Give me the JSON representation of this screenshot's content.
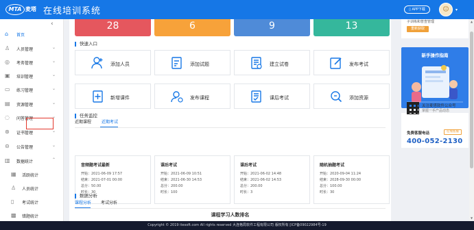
{
  "header": {
    "logo_text": "MTA",
    "logo_name": "麦塔",
    "title": "在线培训系统",
    "app_download": "APP下载"
  },
  "sidebar": {
    "items": [
      {
        "label": "首页",
        "icon": "home-icon",
        "active": true
      },
      {
        "label": "人员管理",
        "icon": "user-icon"
      },
      {
        "label": "考务管理",
        "icon": "exam-icon"
      },
      {
        "label": "培训管理",
        "icon": "training-icon"
      },
      {
        "label": "练习管理",
        "icon": "practice-icon"
      },
      {
        "label": "资源管理",
        "icon": "resource-icon"
      },
      {
        "label": "问答管理",
        "icon": "qa-icon"
      },
      {
        "label": "证书管理",
        "icon": "certificate-icon"
      },
      {
        "label": "公告管理",
        "icon": "announcement-icon"
      },
      {
        "label": "数据统计",
        "icon": "stats-icon",
        "expanded": true
      }
    ],
    "subitems": [
      {
        "label": "活跃统计"
      },
      {
        "label": "人员统计"
      },
      {
        "label": "考试统计"
      },
      {
        "label": "错题统计"
      }
    ]
  },
  "stats": [
    {
      "value": "28",
      "color": "#e5575e"
    },
    {
      "value": "6",
      "color": "#f7a23a"
    },
    {
      "value": "9",
      "color": "#4f8bd8"
    },
    {
      "value": "13",
      "color": "#35b79c"
    }
  ],
  "quick_entry": {
    "title": "快速入口",
    "items": [
      {
        "label": "添加人员",
        "icon": "add-user-icon"
      },
      {
        "label": "添加试题",
        "icon": "add-question-icon"
      },
      {
        "label": "建立试卷",
        "icon": "create-paper-icon"
      },
      {
        "label": "发布考试",
        "icon": "publish-exam-icon"
      },
      {
        "label": "新增课件",
        "icon": "add-courseware-icon"
      },
      {
        "label": "发布课程",
        "icon": "publish-course-icon"
      },
      {
        "label": "课后考试",
        "icon": "post-course-exam-icon"
      },
      {
        "label": "添加资源",
        "icon": "add-resource-icon"
      }
    ]
  },
  "task_monitor": {
    "title": "任务监控",
    "tabs": [
      "近期课程",
      "近期考试"
    ],
    "active_tab": 1,
    "cards": [
      {
        "name": "音频题考试最新",
        "start": "开始：2021-06-09 17:57",
        "end": "结束：2021-07-01 00:00",
        "score": "总分：50.00",
        "duration": "时长：30"
      },
      {
        "name": "课后考试",
        "start": "开始：2021-06-09 10:51",
        "end": "结束：2021-06-30 14:53",
        "score": "总分：200.00",
        "duration": "时长：100"
      },
      {
        "name": "课后考试",
        "start": "开始：2021-06-02 14:48",
        "end": "结束：2021-06-02 14:53",
        "score": "总分：200.00",
        "duration": "时长：3"
      },
      {
        "name": "随机抽题考试",
        "start": "开始：2020-09-04 11:24",
        "end": "结束：2028-09-30 00:00",
        "score": "总分：100.00",
        "duration": "时长：30"
      }
    ]
  },
  "data_analysis": {
    "title": "数据分析",
    "tabs": [
      "课程分析",
      "考试分析"
    ],
    "active_tab": 0,
    "chart_heading": "课程学习人数排名"
  },
  "right_panel": {
    "top_text": "子训练和普查管理",
    "top_button": "重新获取",
    "guide_title": "新手操作指南",
    "wechat_line1": "关注麦塔软件公众号",
    "wechat_line2": "掌握一手产品动态",
    "hotline_label": "免费客服电话",
    "hotline_badge": "在线客服",
    "hotline_number": "400-052-2130"
  },
  "footer": {
    "copyright": "Copyright © 2019 itesoft.com All rights reserved 大连格局软件工程有限公司 版权所有 [ICP备09022984号-19"
  }
}
